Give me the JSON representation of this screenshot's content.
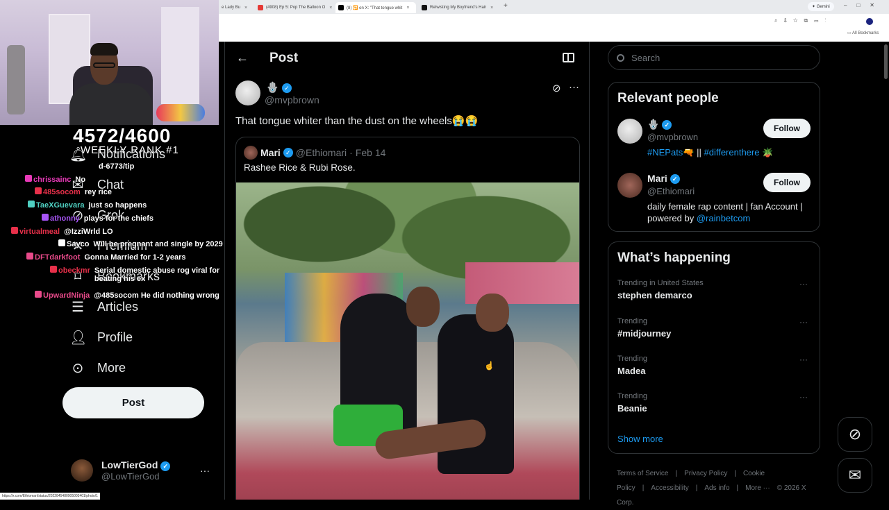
{
  "browser": {
    "tabs": [
      {
        "label": "e Lady Bu",
        "active": false
      },
      {
        "label": "(4908) Ep 5: Pop The Balloon O",
        "active": false
      },
      {
        "label": "(8) 🔁 on X: \"That tongue whit",
        "active": true
      },
      {
        "label": "Retwisting My Boyfriend's Hair",
        "active": false
      }
    ],
    "new_tab": "+",
    "gemini_label": "Gemini",
    "bookmarks_label": "All Bookmarks",
    "status_url": "https://x.com/Ethiomari/status/2022845480905003401/photo/1"
  },
  "stream": {
    "sub_count": "4572/4600",
    "weekly": "WEEKLY RANK #1",
    "tip_line": "d-6773/tip",
    "chat": [
      {
        "user": "chrissainc",
        "msg": "No",
        "color": "#e83ab8"
      },
      {
        "user": "485socom",
        "msg": "rey rice",
        "color": "#e8304a"
      },
      {
        "user": "TaeXGuevara",
        "msg": "just so happens",
        "color": "#4fd0c2"
      },
      {
        "user": "athonny",
        "msg": "plays for the chiefs",
        "color": "#a855f7"
      },
      {
        "user": "virtualmeal",
        "msg": "@IzziWrld LO",
        "color": "#e8304a"
      },
      {
        "user": "Sayco",
        "msg": "Will be pregnant and single by 2029",
        "color": "#ffffff"
      },
      {
        "user": "DFTdarkfoot",
        "msg": "Gonna Married for 1-2 years",
        "color": "#e84a8a"
      },
      {
        "user": "obeckmr",
        "msg": "Serial domestic abuse rog viral for beating his ex",
        "color": "#e8304a"
      },
      {
        "user": "UpwardNinja",
        "msg": "@485socom He did nothing wrong",
        "color": "#e84a8a"
      }
    ]
  },
  "left_nav": {
    "items": [
      {
        "label": "Notifications",
        "icon": "bell-icon"
      },
      {
        "label": "Chat",
        "icon": "envelope-icon"
      },
      {
        "label": "Grok",
        "icon": "grok-icon"
      },
      {
        "label": "Premium",
        "icon": "x-logo-icon"
      },
      {
        "label": "Bookmarks",
        "icon": "bookmark-icon"
      },
      {
        "label": "Articles",
        "icon": "article-icon"
      },
      {
        "label": "Profile",
        "icon": "person-icon"
      },
      {
        "label": "More",
        "icon": "more-circle-icon"
      }
    ],
    "post_button": "Post",
    "account": {
      "name": "LowTierGod",
      "handle": "@LowTierGod",
      "more": "···"
    }
  },
  "main": {
    "title": "Post",
    "post": {
      "author_name": "🪬",
      "author_handle": "@mvpbrown",
      "text": "That tongue whiter than the dust on the wheels😭😭",
      "quote": {
        "name": "Mari",
        "handle": "@Ethiomari",
        "date": "Feb 14",
        "text": "Rashee Rice & Rubi Rose."
      }
    }
  },
  "right": {
    "search_placeholder": "Search",
    "relevant_title": "Relevant people",
    "people": [
      {
        "name": "🪬",
        "handle": "@mvpbrown",
        "bio_link1": "#NEPats",
        "bio_mid": "🔫 || ",
        "bio_link2": "#differenthere",
        "bio_end": " 🪴",
        "follow": "Follow"
      },
      {
        "name": "Mari",
        "handle": "@Ethiomari",
        "bio": "daily female rap content | fan Account | powered by ",
        "bio_link": "@rainbetcom",
        "follow": "Follow"
      }
    ],
    "happening_title": "What’s happening",
    "trends": [
      {
        "context": "Trending in United States",
        "title": "stephen demarco"
      },
      {
        "context": "Trending",
        "title": "#midjourney"
      },
      {
        "context": "Trending",
        "title": "Madea"
      },
      {
        "context": "Trending",
        "title": "Beanie"
      }
    ],
    "show_more": "Show more",
    "footer": [
      "Terms of Service",
      "|",
      "Privacy Policy",
      "|",
      "Cookie Policy",
      "|",
      "Accessibility",
      "|",
      "Ads info",
      "|",
      "More ···",
      "© 2026 X Corp."
    ]
  },
  "colors": {
    "accent": "#1d9bf0",
    "background": "#000000",
    "text": "#e7e9ea",
    "muted": "#71767b",
    "border": "#2f3336"
  }
}
